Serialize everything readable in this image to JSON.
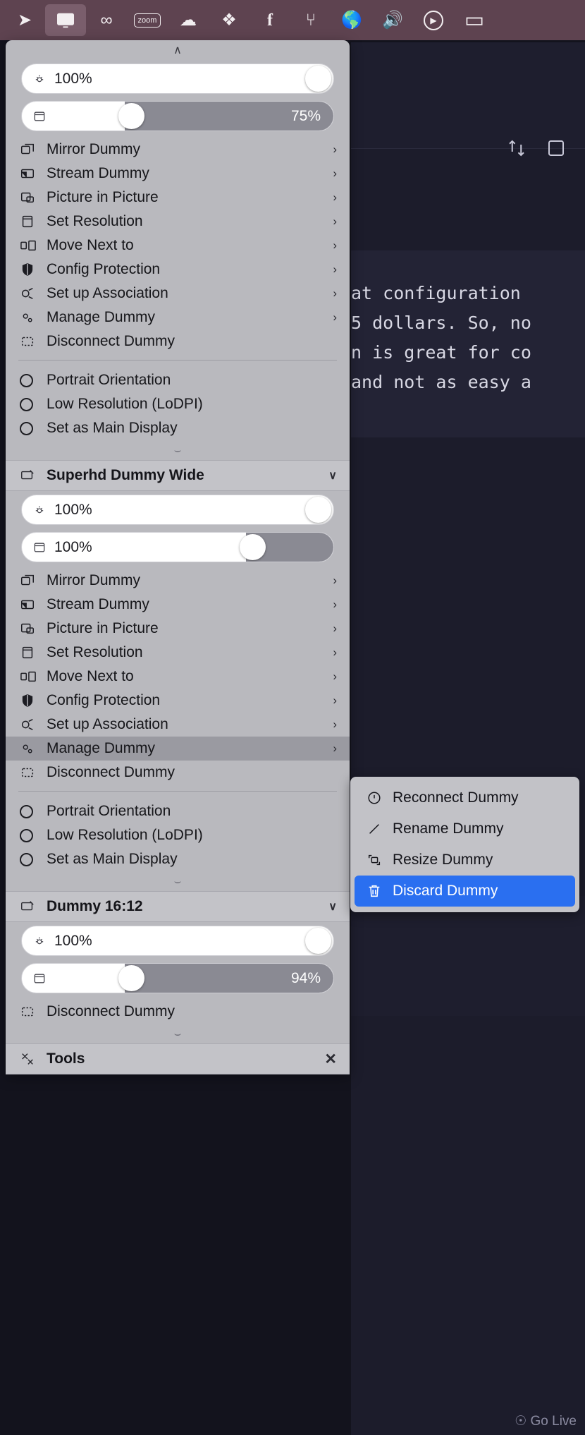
{
  "menubar": {
    "items": [
      {
        "name": "location-arrow-icon",
        "glyph": "➤"
      },
      {
        "name": "display-icon",
        "glyph": "⬜",
        "active": true
      },
      {
        "name": "meta-icon",
        "glyph": "∞"
      },
      {
        "name": "zoom-icon",
        "glyph": "zoom"
      },
      {
        "name": "cloud-icon",
        "glyph": "☁"
      },
      {
        "name": "dropbox-icon",
        "glyph": "❖"
      },
      {
        "name": "facebook-icon",
        "glyph": "f"
      },
      {
        "name": "bitbucket-icon",
        "glyph": "⑂"
      },
      {
        "name": "globe-lock-icon",
        "glyph": "🌎"
      },
      {
        "name": "volume-icon",
        "glyph": "🔊"
      },
      {
        "name": "play-circle-icon",
        "glyph": "▶"
      },
      {
        "name": "battery-icon",
        "glyph": "▭"
      }
    ]
  },
  "background": {
    "code_lines": [
      "at configuration",
      "5 dollars. So, no",
      "n is great for co",
      "and not as easy a"
    ],
    "go_live": "Go Live",
    "toolbar_icons": [
      "split-editor-icon",
      "new-window-icon"
    ]
  },
  "panel": {
    "top_chevron": "∧",
    "display_1": {
      "brightness": {
        "icon": "brightness-icon",
        "value": "100%",
        "percent": 100
      },
      "volume": {
        "icon": "display-box-icon",
        "value": "75%",
        "percent": 33
      },
      "menu_items": [
        {
          "label": "Mirror Dummy",
          "icon": "mirror-icon",
          "arrow": "›"
        },
        {
          "label": "Stream Dummy",
          "icon": "stream-icon",
          "arrow": "›"
        },
        {
          "label": "Picture in Picture",
          "icon": "pip-icon",
          "arrow": "›"
        },
        {
          "label": "Set Resolution",
          "icon": "resolution-icon",
          "arrow": "›"
        },
        {
          "label": "Move Next to",
          "icon": "move-next-icon",
          "arrow": "›"
        },
        {
          "label": "Config Protection",
          "icon": "shield-icon",
          "arrow": "›"
        },
        {
          "label": "Set up Association",
          "icon": "association-icon",
          "arrow": "›"
        },
        {
          "label": "Manage Dummy",
          "icon": "gears-icon",
          "arrow": "›"
        },
        {
          "label": "Disconnect Dummy",
          "icon": "disconnect-icon",
          "arrow": ""
        }
      ],
      "radio_items": [
        {
          "label": "Portrait Orientation"
        },
        {
          "label": "Low Resolution (LoDPI)"
        },
        {
          "label": "Set as Main Display"
        }
      ],
      "bottom_chevron": "⌣"
    },
    "display_2": {
      "header": {
        "label": "Superhd Dummy Wide",
        "icon": "display-tag-icon",
        "chevron": "∨"
      },
      "brightness": {
        "icon": "brightness-icon",
        "value": "100%",
        "percent": 100
      },
      "volume": {
        "icon": "display-box-icon",
        "value": "100%",
        "percent": 72
      },
      "menu_items": [
        {
          "label": "Mirror Dummy",
          "icon": "mirror-icon",
          "arrow": "›"
        },
        {
          "label": "Stream Dummy",
          "icon": "stream-icon",
          "arrow": "›"
        },
        {
          "label": "Picture in Picture",
          "icon": "pip-icon",
          "arrow": "›"
        },
        {
          "label": "Set Resolution",
          "icon": "resolution-icon",
          "arrow": "›"
        },
        {
          "label": "Move Next to",
          "icon": "move-next-icon",
          "arrow": "›"
        },
        {
          "label": "Config Protection",
          "icon": "shield-icon",
          "arrow": "›"
        },
        {
          "label": "Set up Association",
          "icon": "association-icon",
          "arrow": "›"
        },
        {
          "label": "Manage Dummy",
          "icon": "gears-icon",
          "arrow": "›",
          "selected": true
        },
        {
          "label": "Disconnect Dummy",
          "icon": "disconnect-icon",
          "arrow": ""
        }
      ],
      "radio_items": [
        {
          "label": "Portrait Orientation"
        },
        {
          "label": "Low Resolution (LoDPI)"
        },
        {
          "label": "Set as Main Display"
        }
      ],
      "bottom_chevron": "⌣"
    },
    "display_3": {
      "header": {
        "label": "Dummy 16:12",
        "icon": "display-tag-icon",
        "chevron": "∨"
      },
      "brightness": {
        "icon": "brightness-icon",
        "value": "100%",
        "percent": 100
      },
      "volume": {
        "icon": "display-box-icon",
        "value": "94%",
        "percent": 33
      },
      "menu_items": [
        {
          "label": "Disconnect Dummy",
          "icon": "disconnect-icon",
          "arrow": ""
        }
      ],
      "bottom_chevron": "⌣"
    },
    "tools": {
      "label": "Tools",
      "icon": "tools-icon",
      "close": "✕"
    }
  },
  "submenu": {
    "items": [
      {
        "label": "Reconnect Dummy",
        "icon": "reconnect-icon",
        "highlighted": false
      },
      {
        "label": "Rename Dummy",
        "icon": "rename-icon",
        "highlighted": false
      },
      {
        "label": "Resize Dummy",
        "icon": "resize-icon",
        "highlighted": false
      },
      {
        "label": "Discard Dummy",
        "icon": "trash-icon",
        "highlighted": true
      }
    ],
    "highlight_color": "#2a6ff0"
  }
}
